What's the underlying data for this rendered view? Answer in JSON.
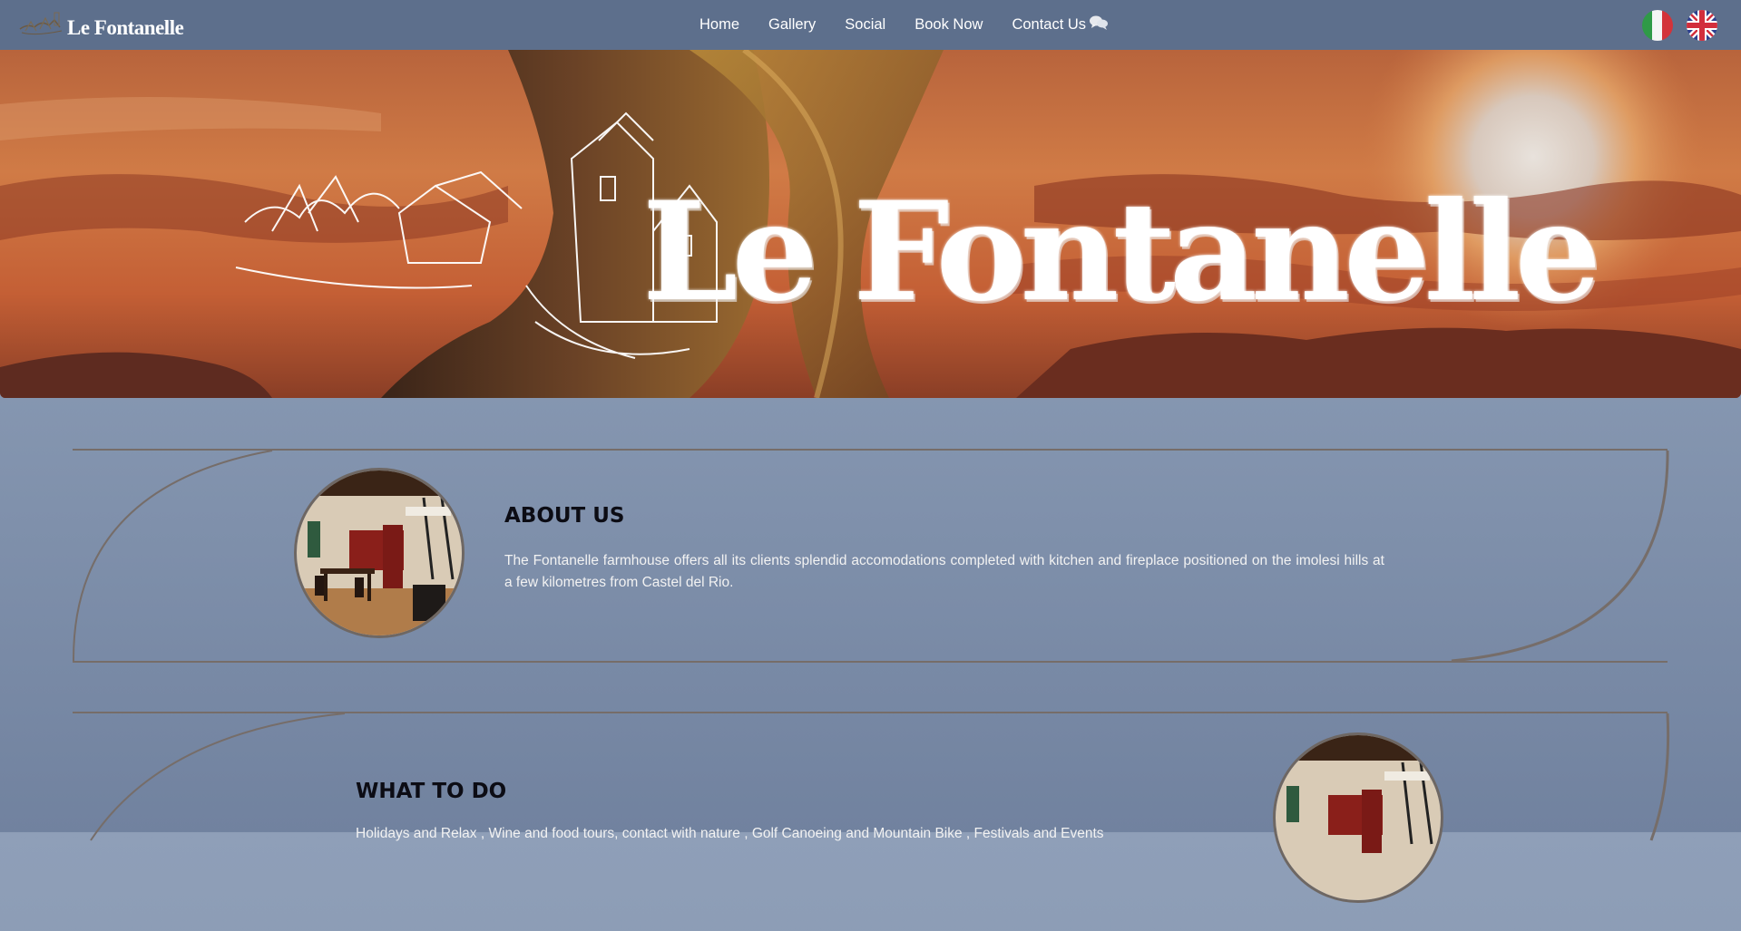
{
  "brand": {
    "name": "Le Fontanelle"
  },
  "nav": {
    "items": [
      {
        "label": "Home"
      },
      {
        "label": "Gallery"
      },
      {
        "label": "Social"
      },
      {
        "label": "Book Now"
      },
      {
        "label": "Contact Us"
      }
    ]
  },
  "languages": [
    {
      "icon": "italian-flag-icon"
    },
    {
      "icon": "uk-flag-icon"
    }
  ],
  "hero": {
    "title": "Le Fontanelle"
  },
  "sections": [
    {
      "title": "ABOUT US",
      "text": "The Fontanelle farmhouse offers all its clients splendid accomodations completed with kitchen and fireplace positioned on the imolesi hills at a few kilometres from Castel del Rio."
    },
    {
      "title": "WHAT TO DO",
      "text": "Holidays and Relax , Wine and food tours, contact with nature , Golf Canoeing and Mountain Bike , Festivals and Events"
    }
  ],
  "colors": {
    "topbar": "#5d6f8c",
    "page_gradient_top": "#8f9fb8",
    "panel_border": "#766d69",
    "accent_text": "#0c0c14"
  }
}
